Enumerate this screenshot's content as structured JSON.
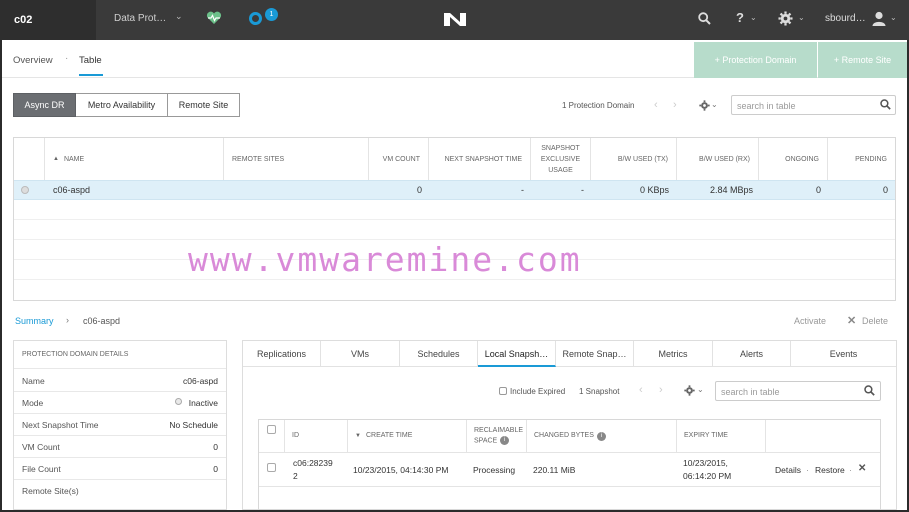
{
  "topbar": {
    "cluster_name": "c02",
    "nav_label": "Data Prot…",
    "alert_count": "1",
    "user_name": "sbourd…",
    "help_label": "?"
  },
  "subnav": {
    "tab_overview": "Overview",
    "tab_separator": "·",
    "tab_table": "Table",
    "btn_protection_domain": "+ Protection Domain",
    "btn_remote_site": "+ Remote Site"
  },
  "segments": {
    "async": "Async DR",
    "metro": "Metro Availability",
    "remote": "Remote Site"
  },
  "table_toolbar": {
    "count_label": "1 Protection Domain",
    "search_placeholder": "search in table"
  },
  "main_table": {
    "headers": {
      "name": "NAME",
      "remote_sites": "REMOTE SITES",
      "vm_count": "VM COUNT",
      "next_snapshot": "NEXT SNAPSHOT TIME",
      "snapshot_exclusive": "SNAPSHOT EXCLUSIVE USAGE",
      "bw_tx": "B/W USED (TX)",
      "bw_rx": "B/W USED (RX)",
      "ongoing": "ONGOING",
      "pending": "PENDING"
    },
    "rows": [
      {
        "name": "c06-aspd",
        "remote_sites": "",
        "vm_count": "0",
        "next_snapshot": "-",
        "snapshot_exclusive": "-",
        "bw_tx": "0 KBps",
        "bw_rx": "2.84 MBps",
        "ongoing": "0",
        "pending": "0"
      }
    ]
  },
  "watermark": "www.vmwaremine.com",
  "breadcrumb": {
    "summary": "Summary",
    "chevron": "›",
    "current": "c06-aspd"
  },
  "actions": {
    "activate": "Activate",
    "delete_icon": "✕",
    "delete": "Delete"
  },
  "details": {
    "title": "PROTECTION DOMAIN DETAILS",
    "rows": [
      {
        "key": "Name",
        "value": "c06-aspd"
      },
      {
        "key": "Mode",
        "value": "Inactive"
      },
      {
        "key": "Next Snapshot Time",
        "value": "No Schedule"
      },
      {
        "key": "VM Count",
        "value": "0"
      },
      {
        "key": "File Count",
        "value": "0"
      },
      {
        "key": "Remote Site(s)",
        "value": ""
      }
    ]
  },
  "detail_tabs": [
    "Replications",
    "VMs",
    "Schedules",
    "Local Snapsh…",
    "Remote Snap…",
    "Metrics",
    "Alerts",
    "Events"
  ],
  "snap_toolbar": {
    "include_expired": "Include Expired",
    "count_label": "1 Snapshot",
    "search_placeholder": "search in table"
  },
  "snap_table": {
    "headers": {
      "id": "ID",
      "create_time": "CREATE TIME",
      "reclaimable": "RECLAIMABLE SPACE",
      "changed_bytes": "CHANGED BYTES",
      "expiry_time": "EXPIRY TIME"
    },
    "rows": [
      {
        "id_line1": "c06:28239",
        "id_line2": "2",
        "create_time": "10/23/2015, 04:14:30 PM",
        "reclaimable": "Processing",
        "changed_bytes": "220.11 MiB",
        "expiry_line1": "10/23/2015,",
        "expiry_line2": "06:14:20 PM",
        "action_details": "Details",
        "action_restore": "Restore",
        "action_sep": "·",
        "action_delete_icon": "✕"
      }
    ]
  },
  "colors": {
    "accent": "#1a9ad6",
    "topbar": "#3a3a3a",
    "green_button": "#b7dccb",
    "selected_row": "#dff0f9",
    "watermark": "#d98ad8"
  }
}
